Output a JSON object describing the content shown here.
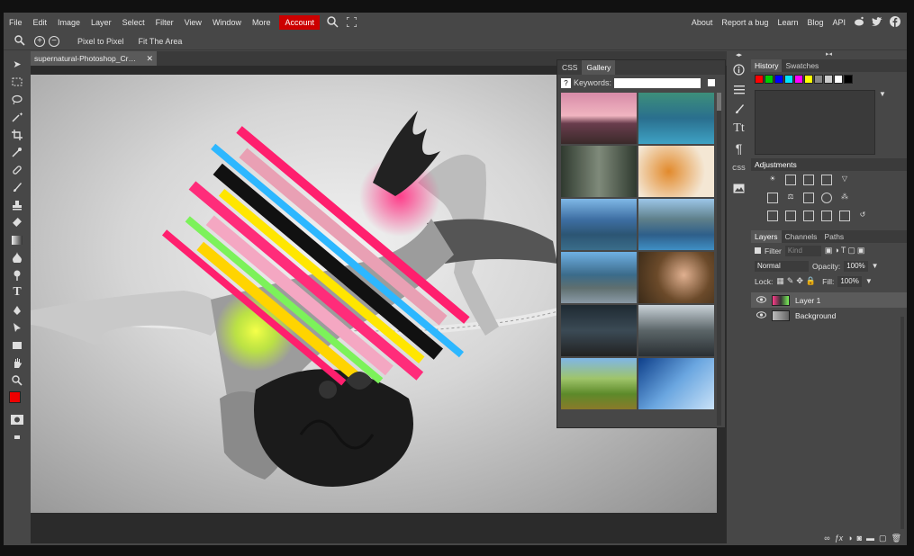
{
  "menu": {
    "items": [
      "File",
      "Edit",
      "Image",
      "Layer",
      "Select",
      "Filter",
      "View",
      "Window",
      "More"
    ],
    "account": "Account",
    "right_links": [
      "About",
      "Report a bug",
      "Learn",
      "Blog",
      "API"
    ],
    "account_color": "#cc0000"
  },
  "options": {
    "pixel_to_pixel": "Pixel to Pixel",
    "fit_area": "Fit The Area"
  },
  "document": {
    "tab_title": "supernatural-Photoshop_Cr",
    "close": "✕"
  },
  "gallery": {
    "tabs": [
      "CSS",
      "Gallery"
    ],
    "active_tab": "Gallery",
    "keywords_label": "Keywords:",
    "help": "?",
    "keywords_value": "",
    "thumbnails": [
      "tree-sunset",
      "lake-forest",
      "forest-road",
      "autumn-leaves",
      "alpine-village",
      "mountain-lake",
      "fjord-mountains",
      "woman-forest",
      "highway-night",
      "city-street",
      "green-hills",
      "skyscraper"
    ]
  },
  "right_panel": {
    "history_tabs": [
      "History",
      "Swatches"
    ],
    "swatch_colors": [
      "#ff0000",
      "#00cc00",
      "#0000ff",
      "#00e5ff",
      "#ff00ff",
      "#ffff00",
      "#888888",
      "#cccccc",
      "#ffffff",
      "#000000"
    ],
    "adjustments_title": "Adjustments",
    "layers_tabs": [
      "Layers",
      "Channels",
      "Paths"
    ],
    "filter_label": "Filter",
    "kind_label": "Kind",
    "blend_mode": "Normal",
    "opacity_label": "Opacity:",
    "opacity_value": "100%",
    "lock_label": "Lock:",
    "fill_label": "Fill:",
    "fill_value": "100%",
    "layers": [
      {
        "name": "Layer 1",
        "selected": true
      },
      {
        "name": "Background",
        "selected": false
      }
    ]
  },
  "colors": {
    "foreground": "#ee0000",
    "background": "#000000"
  }
}
